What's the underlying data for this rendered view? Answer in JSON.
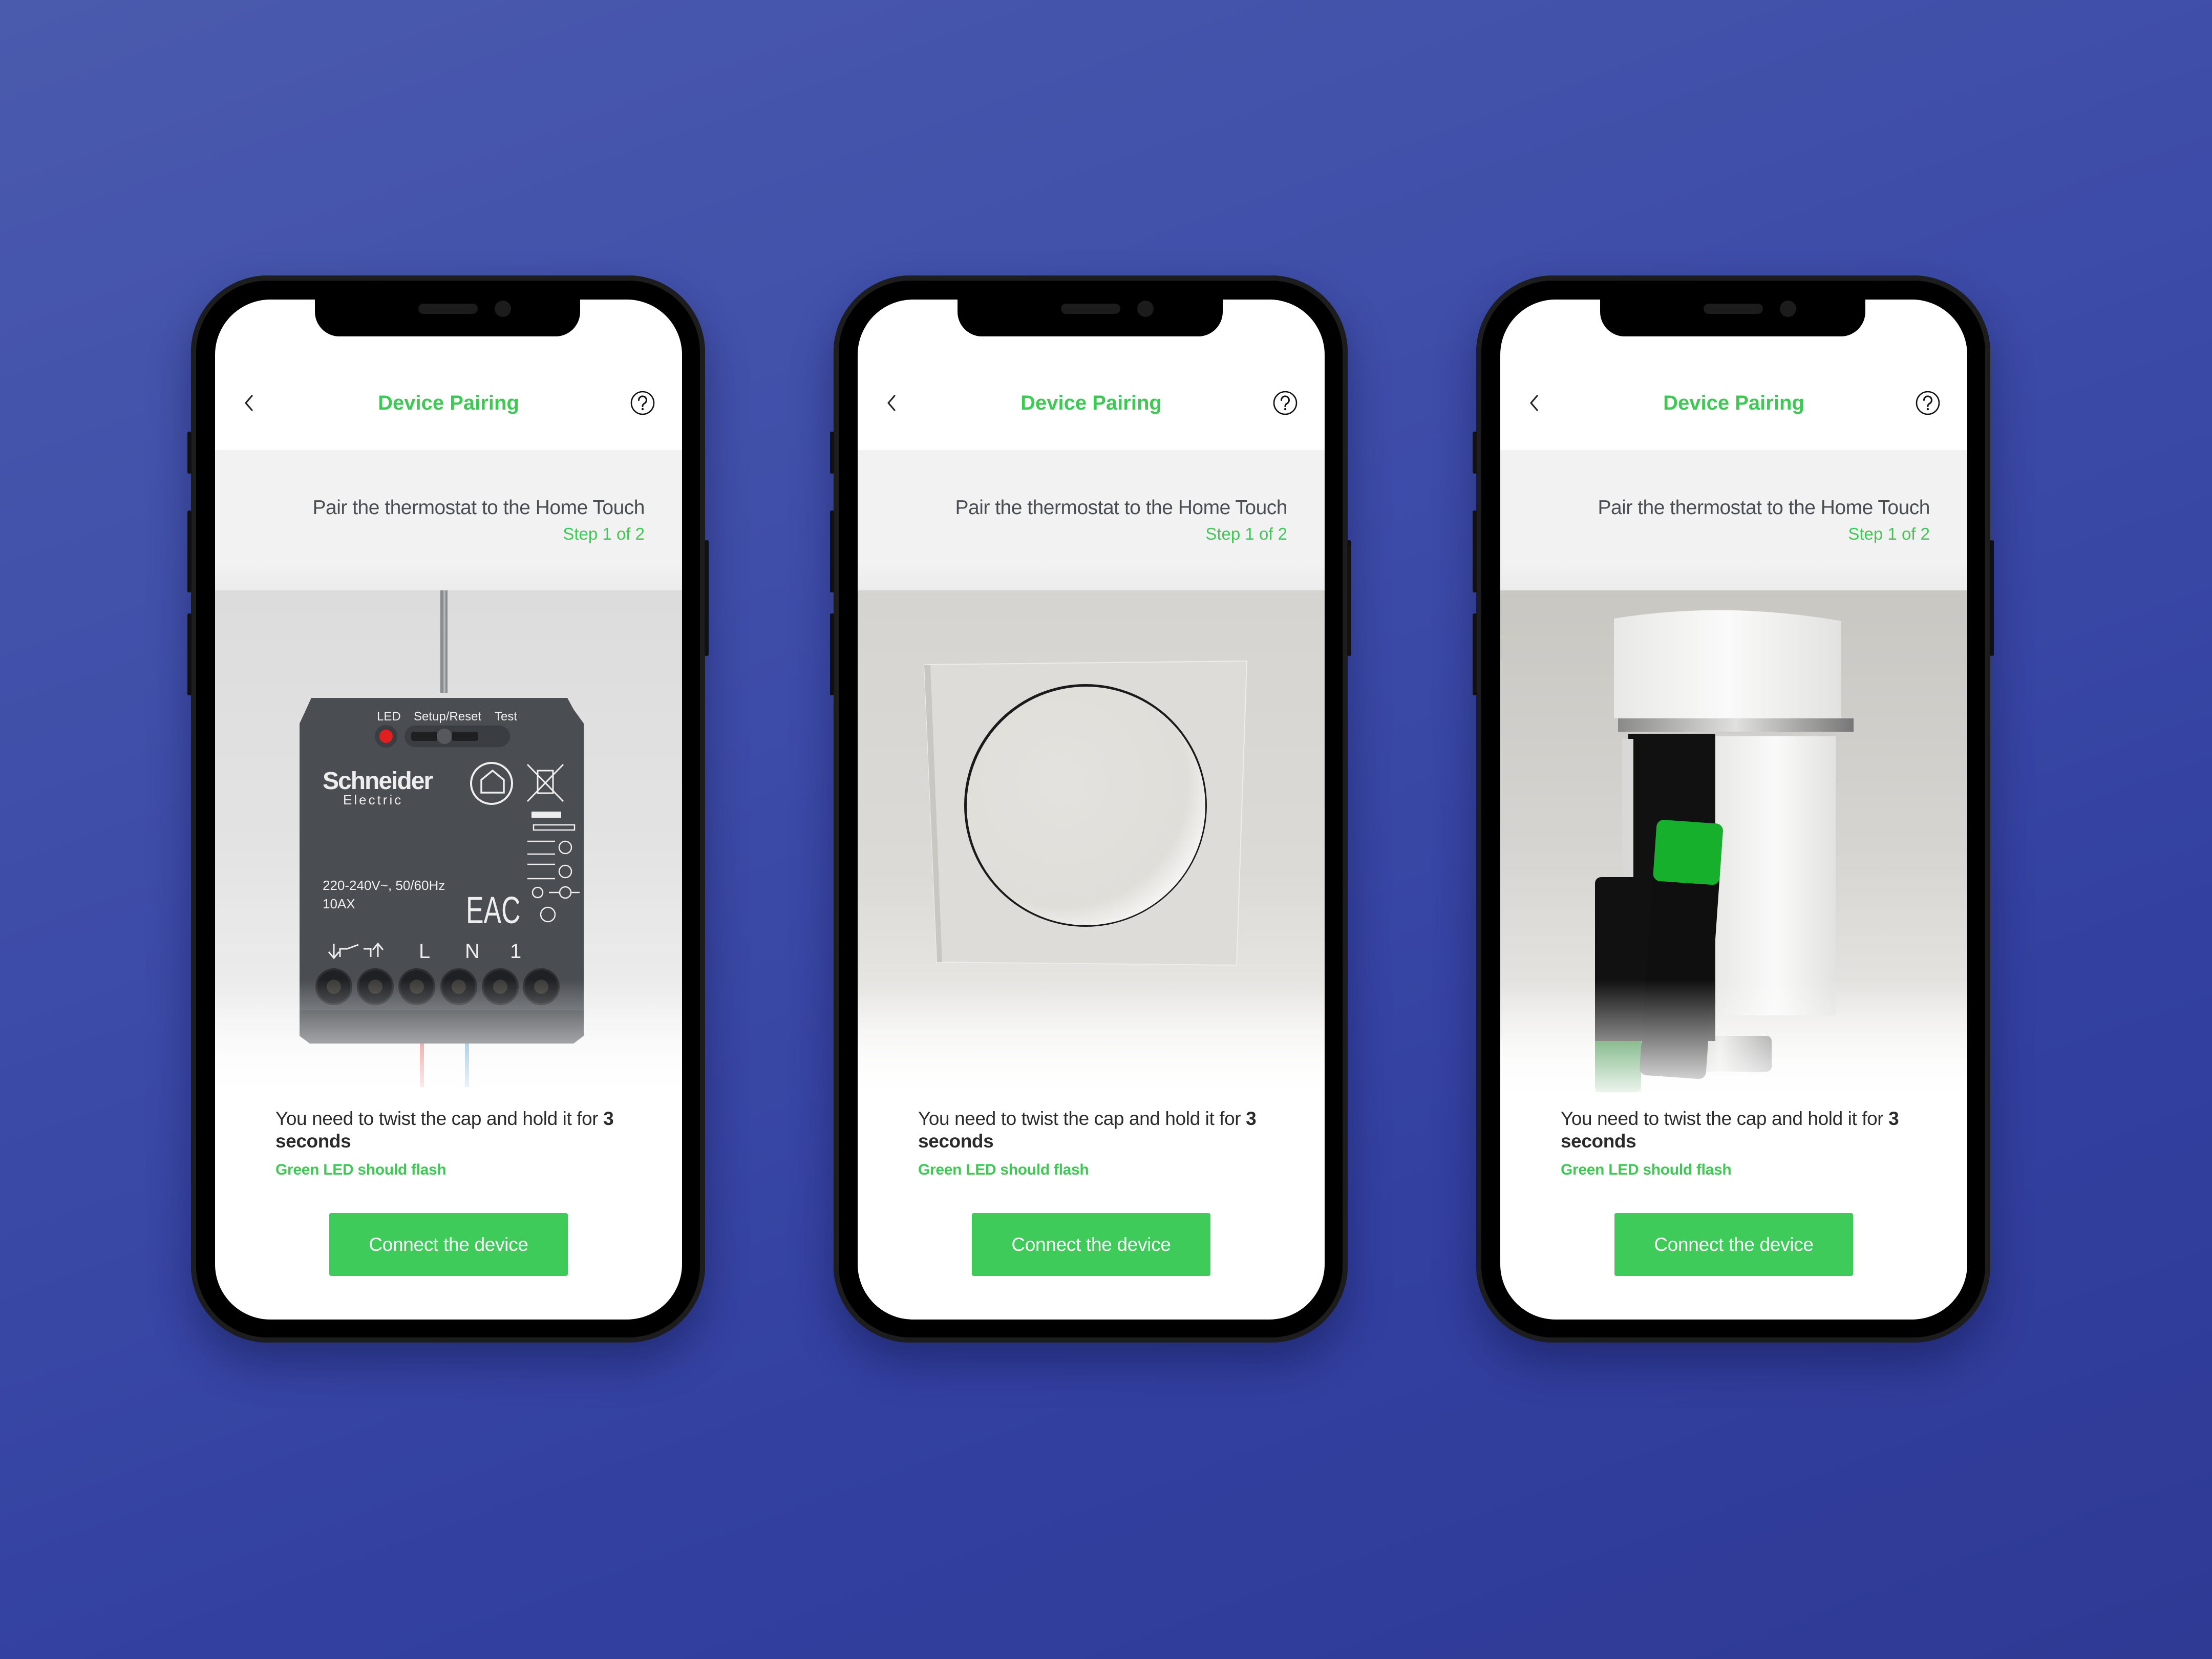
{
  "theme": {
    "accent": "#3dc954",
    "button_bg": "#3ecb59",
    "background_top": "#4a5aad",
    "background_bottom": "#2e3a94"
  },
  "phones": [
    {
      "header": {
        "title": "Device Pairing",
        "back_icon": "chevron-left-icon",
        "help_icon": "question-circle-icon"
      },
      "band": {
        "title": "Pair the thermostat to the Home Touch",
        "step": "Step 1 of 2"
      },
      "hero": {
        "subject": "schneider-electric-micro-module",
        "labels": {
          "led": "LED",
          "setup": "Setup/Reset",
          "test": "Test",
          "brand": "Schneider",
          "brand_sub": "Electric",
          "rating": "220-240V~, 50/60Hz",
          "amps": "10AX",
          "mark": "EAC",
          "terminals": [
            "L",
            "N",
            "1"
          ]
        }
      },
      "instruction": {
        "text": "You need to twist the cap and hold it for ",
        "bold": "3 seconds"
      },
      "hint": "Green LED should flash",
      "button": "Connect the device"
    },
    {
      "header": {
        "title": "Device Pairing",
        "back_icon": "chevron-left-icon",
        "help_icon": "question-circle-icon"
      },
      "band": {
        "title": "Pair the thermostat to the Home Touch",
        "step": "Step 1 of 2"
      },
      "hero": {
        "subject": "rotary-dial-wall-thermostat"
      },
      "instruction": {
        "text": "You need to twist the cap and hold it for ",
        "bold": "3 seconds"
      },
      "hint": "Green LED should flash",
      "button": "Connect the device"
    },
    {
      "header": {
        "title": "Device Pairing",
        "back_icon": "chevron-left-icon",
        "help_icon": "question-circle-icon"
      },
      "band": {
        "title": "Pair the thermostat to the Home Touch",
        "step": "Step 1 of 2"
      },
      "hero": {
        "subject": "radiator-thermostat-with-batteries"
      },
      "instruction": {
        "text": "You need to twist the cap and hold it for ",
        "bold": "3 seconds"
      },
      "hint": "Green LED should flash",
      "button": "Connect the device"
    }
  ]
}
